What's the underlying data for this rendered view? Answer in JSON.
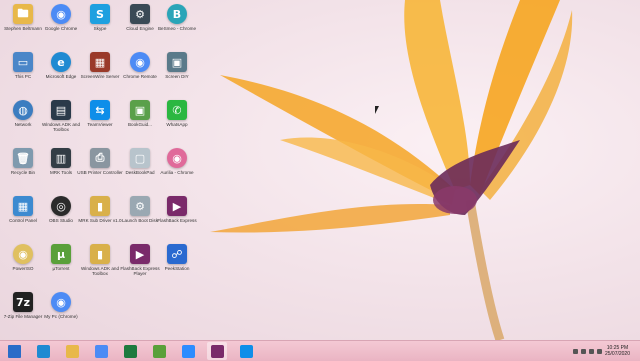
{
  "desktop": {
    "icons": [
      {
        "label": "Stephen Beltmann",
        "name": "user-folder-icon",
        "color": "#e8b84a",
        "glyph": "🖿"
      },
      {
        "label": "Google Chrome",
        "name": "chrome-icon",
        "color": "#4c8bf5",
        "glyph": "◉"
      },
      {
        "label": "Skype",
        "name": "skype-icon",
        "color": "#1ea0e0",
        "glyph": "S"
      },
      {
        "label": "Cloud Engine",
        "name": "cloud-engine-icon",
        "color": "#3a4a56",
        "glyph": "⚙"
      },
      {
        "label": "BeSmeo - Chrome",
        "name": "chrome-app-icon",
        "color": "#2aa5b8",
        "glyph": "B"
      },
      {
        "label": "This PC",
        "name": "this-pc-icon",
        "color": "#4a86c8",
        "glyph": "▭"
      },
      {
        "label": "Microsoft Edge",
        "name": "edge-icon",
        "color": "#1f8ad2",
        "glyph": "e"
      },
      {
        "label": "ScreenWire Server",
        "name": "screenwire-icon",
        "color": "#9a3a2a",
        "glyph": "▦"
      },
      {
        "label": "Chrome Remote",
        "name": "chrome-remote-icon",
        "color": "#4c8bf5",
        "glyph": "◉"
      },
      {
        "label": "Screen DIY",
        "name": "screen-diy-icon",
        "color": "#5a7a8a",
        "glyph": "▣"
      },
      {
        "label": "Network",
        "name": "network-icon",
        "color": "#3c7dc0",
        "glyph": "◍"
      },
      {
        "label": "Windows ADK and Toolbox",
        "name": "windows-adk-icon",
        "color": "#2a3a4a",
        "glyph": "▤"
      },
      {
        "label": "TeamViewer",
        "name": "teamviewer-icon",
        "color": "#0e8ee9",
        "glyph": "⇆"
      },
      {
        "label": "BookGuid...",
        "name": "bookguid-icon",
        "color": "#5aa04a",
        "glyph": "▣"
      },
      {
        "label": "WhatsApp",
        "name": "whatsapp-icon",
        "color": "#2bb741",
        "glyph": "✆"
      },
      {
        "label": "Recycle Bin",
        "name": "recycle-bin-icon",
        "color": "#7f9aae",
        "glyph": "🗑"
      },
      {
        "label": "MRK Tools",
        "name": "mrk-tools-icon",
        "color": "#333d45",
        "glyph": "▥"
      },
      {
        "label": "USB Printer Controller",
        "name": "usb-printer-icon",
        "color": "#8a96a0",
        "glyph": "⎙"
      },
      {
        "label": "DeskBookPad",
        "name": "deskbookpad-icon",
        "color": "#b8c4cc",
        "glyph": "▢"
      },
      {
        "label": "Aurilia - Chrome",
        "name": "aurilia-chrome-icon",
        "color": "#e06a9a",
        "glyph": "◉"
      },
      {
        "label": "Control Panel",
        "name": "control-panel-icon",
        "color": "#3c8ad0",
        "glyph": "▦"
      },
      {
        "label": "OBS Studio",
        "name": "obs-studio-icon",
        "color": "#2b2b2b",
        "glyph": "◎"
      },
      {
        "label": "MRK Sub Driver v1.0",
        "name": "mrk-driver-icon",
        "color": "#d9b04a",
        "glyph": "▮"
      },
      {
        "label": "Launch Boot Disk",
        "name": "launch-boot-icon",
        "color": "#9aa8b2",
        "glyph": "⚙"
      },
      {
        "label": "FlashBack Express",
        "name": "flashback-express-icon",
        "color": "#7a2a6a",
        "glyph": "▶"
      },
      {
        "label": "PowerISO",
        "name": "poweriso-icon",
        "color": "#e0c060",
        "glyph": "◉"
      },
      {
        "label": "µTorrent",
        "name": "utorrent-icon",
        "color": "#5aa03a",
        "glyph": "µ"
      },
      {
        "label": "Windows ADK and Toolbox",
        "name": "windows-adk-2-icon",
        "color": "#d9b04a",
        "glyph": "▮"
      },
      {
        "label": "FlashBack Express Player",
        "name": "flashback-player-icon",
        "color": "#7a2a6a",
        "glyph": "▶"
      },
      {
        "label": "PeekStation",
        "name": "peekstation-icon",
        "color": "#2a6ad0",
        "glyph": "☍"
      },
      {
        "label": "7-Zip File Manager",
        "name": "7zip-icon",
        "color": "#222222",
        "glyph": "7z"
      },
      {
        "label": "My Pc (Chrome)",
        "name": "mypc-chrome-icon",
        "color": "#4c8bf5",
        "glyph": "◉"
      }
    ]
  },
  "taskbar": {
    "items": [
      {
        "name": "start-button",
        "color": "#2a6cc8"
      },
      {
        "name": "taskbar-edge-icon",
        "color": "#1f8ad2"
      },
      {
        "name": "taskbar-file-explorer-icon",
        "color": "#e8b84a"
      },
      {
        "name": "taskbar-chrome-icon",
        "color": "#4c8bf5"
      },
      {
        "name": "taskbar-excel-icon",
        "color": "#1e7a3e"
      },
      {
        "name": "taskbar-utorrent-icon",
        "color": "#5aa03a"
      },
      {
        "name": "taskbar-zoom-icon",
        "color": "#2d8cff"
      },
      {
        "name": "taskbar-flashback-icon",
        "color": "#7a2a6a"
      },
      {
        "name": "taskbar-teamviewer-icon",
        "color": "#0e8ee9"
      }
    ],
    "clock": {
      "time": "10:25 PM",
      "date": "25/07/2020"
    }
  }
}
